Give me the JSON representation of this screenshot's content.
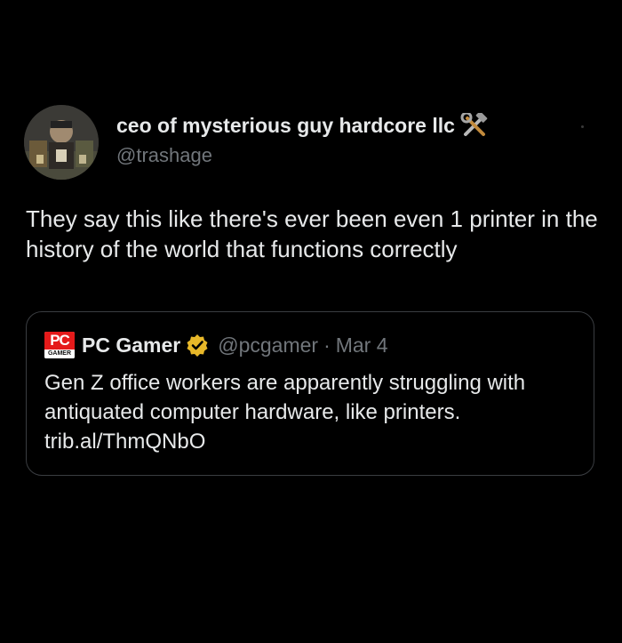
{
  "author": {
    "display_name": "ceo of mysterious guy hardcore llc",
    "handle": "@trashage",
    "badge_icon": "hammer-and-wrench-icon"
  },
  "post": {
    "text": "They say this like there's ever been even 1 printer in the history of the world that functions correctly"
  },
  "quoted_post": {
    "logo_text": "PC",
    "logo_subtext": "GAMER",
    "name": "PC Gamer",
    "verified": true,
    "verified_color": "#e8b829",
    "handle": "@pcgamer",
    "separator": "·",
    "date": "Mar 4",
    "text_line1": "Gen Z office workers are apparently struggling with",
    "text_line2": "antiquated computer hardware, like printers.",
    "link": "trib.al/ThmQNbO"
  },
  "colors": {
    "background": "#000000",
    "primary_text": "#e7e9ea",
    "secondary_text": "#71767b",
    "border": "#3a3d41",
    "pc_gamer_red": "#e51a1a"
  }
}
